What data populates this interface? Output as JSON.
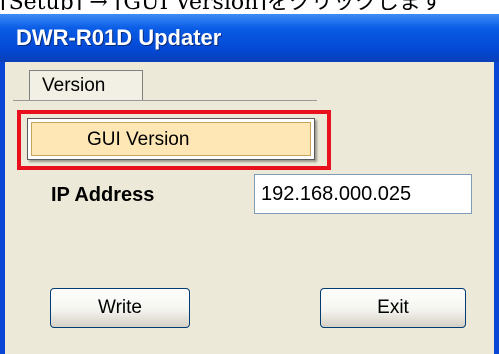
{
  "caption_fragment": "[Setup] → [GUI Version]をクリックします",
  "window": {
    "title": "DWR-R01D Updater"
  },
  "menu": {
    "version_label": "Version",
    "items": [
      "GUI Version"
    ]
  },
  "form": {
    "ip_label": "IP Address",
    "ip_value": "192.168.000.025"
  },
  "buttons": {
    "write_label": "Write",
    "exit_label": "Exit"
  },
  "colors": {
    "titlebar": "#0a5ce6",
    "client": "#ece9d8",
    "highlight": "#e8101c",
    "menu_item_hover": "#ffe7b5"
  }
}
